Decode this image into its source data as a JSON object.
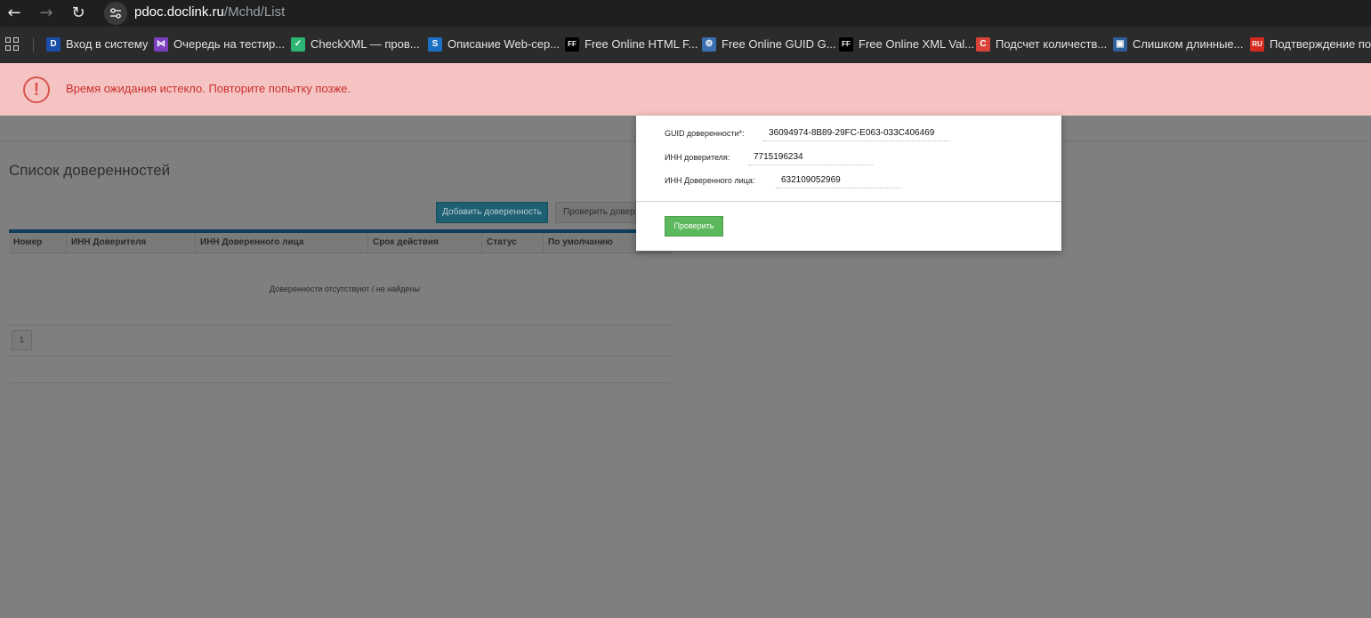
{
  "browser": {
    "url_host": "pdoc.doclink.ru",
    "url_path": "/Mchd/List",
    "nav": {
      "back_icon": "←",
      "forward_icon": "→",
      "reload_icon": "↻"
    }
  },
  "bookmarks": [
    {
      "label": "Вход в систему",
      "icon": "D",
      "icon_color": "#1a4ea8"
    },
    {
      "label": "Очередь на тестир...",
      "icon": "⋈",
      "icon_color": "#7b3fc0"
    },
    {
      "label": "CheckXML — пров...",
      "icon": "✓",
      "icon_color": "#2bb673"
    },
    {
      "label": "Описание Web-сер...",
      "icon": "S",
      "icon_color": "#1b6fc4"
    },
    {
      "label": "Free Online HTML F...",
      "icon": "FF",
      "icon_color": "#000000"
    },
    {
      "label": "Free Online GUID G...",
      "icon": "⚙",
      "icon_color": "#3a6fb0"
    },
    {
      "label": "Free Online XML Val...",
      "icon": "FF",
      "icon_color": "#000000"
    },
    {
      "label": "Подсчет количеств...",
      "icon": "C",
      "icon_color": "#d9443a"
    },
    {
      "label": "Слишком длинные...",
      "icon": "▣",
      "icon_color": "#2f5f9a"
    },
    {
      "label": "Подтверждение по...",
      "icon": "RU",
      "icon_color": "#d52b1e"
    }
  ],
  "alert": {
    "icon": "!",
    "message": "Время ожидания истекло. Повторите попытку позже."
  },
  "page": {
    "title": "Список доверенностей",
    "add_button": "Добавить доверенность",
    "check_button": "Проверить доверенность"
  },
  "table": {
    "columns": [
      "Номер",
      "ИНН Доверителя",
      "ИНН Доверенного лица",
      "Срок действия",
      "Статус",
      "По умолчанию"
    ],
    "empty_message": "Доверенности отсутствуют / не найдены",
    "pager": [
      "1"
    ]
  },
  "modal": {
    "guid_label": "GUID доверенности*:",
    "guid_value": "36094974-8B89-29FC-E063-033C406469",
    "inn_principal_label": "ИНН доверителя:",
    "inn_principal_value": "7715196234",
    "inn_agent_label": "ИНН Доверенного лица:",
    "inn_agent_value": "632109052969",
    "verify_button": "Проверить"
  }
}
